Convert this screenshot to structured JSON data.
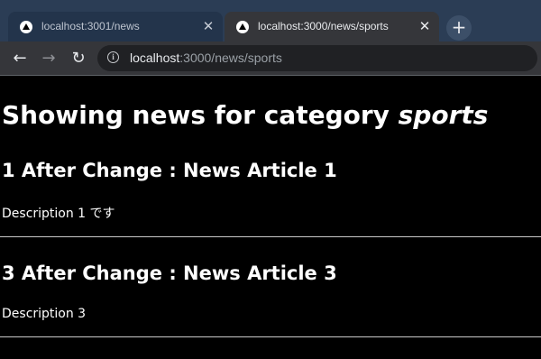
{
  "browser": {
    "tabs": [
      {
        "title": "localhost:3001/news",
        "active": false
      },
      {
        "title": "localhost:3000/news/sports",
        "active": true
      }
    ],
    "close_glyph": "✕",
    "new_tab_glyph": "+",
    "nav": {
      "back": "←",
      "forward": "→",
      "reload": "↻"
    },
    "info_glyph": "i",
    "address": {
      "host": "localhost",
      "rest": ":3000/news/sports"
    },
    "icons": [
      "favicon-icon",
      "close-icon",
      "plus-icon",
      "back-arrow-icon",
      "forward-arrow-icon",
      "reload-icon",
      "info-icon"
    ]
  },
  "page": {
    "heading_prefix": "Showing news for category ",
    "heading_category": "sports",
    "articles": [
      {
        "title": "1 After Change : News Article 1",
        "description": "Description 1 です"
      },
      {
        "title": "3 After Change : News Article 3",
        "description": "Description 3"
      }
    ]
  },
  "colors": {
    "tabstrip": "#2b3d55",
    "active_tab": "#35363a",
    "page_background": "#000000",
    "page_text": "#ffffff",
    "divider": "#c9c9c9"
  }
}
